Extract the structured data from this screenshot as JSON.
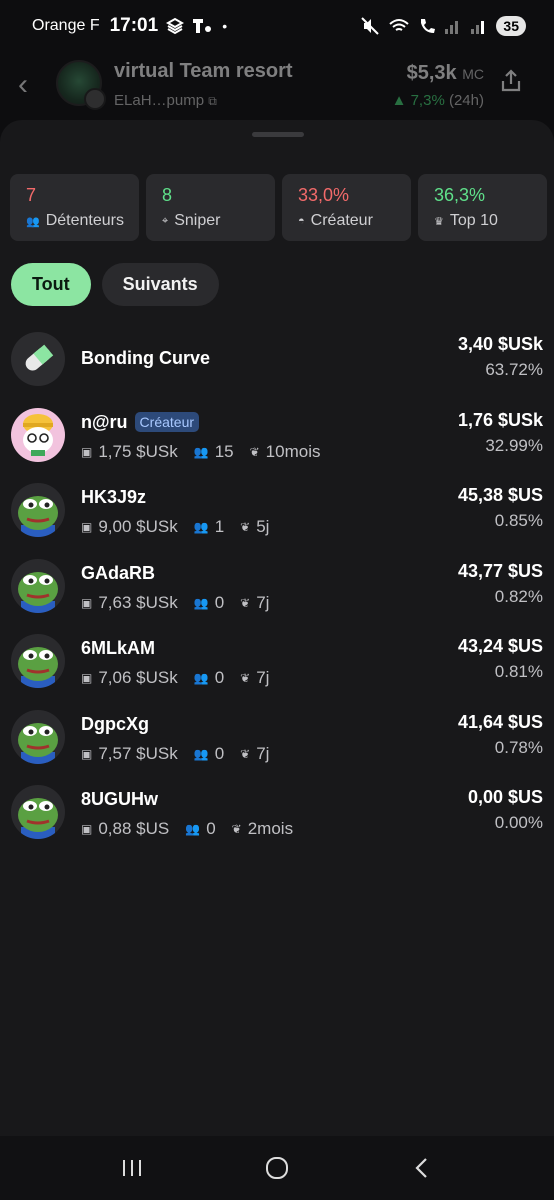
{
  "status_bar": {
    "carrier": "Orange F",
    "time": "17:01",
    "battery": "35"
  },
  "header": {
    "token_name": "virtual Team resort",
    "token_address": "ELaH…pump",
    "market_cap": "$5,3k",
    "market_cap_unit": "MC",
    "change": "7,3%",
    "change_period": "(24h)"
  },
  "stats": [
    {
      "value": "7",
      "label": "Détenteurs",
      "color": "#f26a6a"
    },
    {
      "value": "8",
      "label": "Sniper",
      "color": "#5fe08a"
    },
    {
      "value": "33,0%",
      "label": "Créateur",
      "color": "#f26a6a"
    },
    {
      "value": "36,3%",
      "label": "Top 10",
      "color": "#5fe08a"
    }
  ],
  "tabs": [
    {
      "label": "Tout",
      "active": true
    },
    {
      "label": "Suivants",
      "active": false
    }
  ],
  "holders": [
    {
      "name": "Bonding Curve",
      "amount": "3,40 $USk",
      "percent": "63.72%",
      "avatar": "pill-icon"
    },
    {
      "name": "n@ru",
      "badge": "Créateur",
      "sol": "1,75 $USk",
      "followers": "15",
      "age": "10mois",
      "amount": "1,76 $USk",
      "percent": "32.99%",
      "avatar": "cartoon-avatar"
    },
    {
      "name": "HK3J9z",
      "sol": "9,00 $USk",
      "followers": "1",
      "age": "5j",
      "amount": "45,38 $US",
      "percent": "0.85%",
      "avatar": "frog-avatar"
    },
    {
      "name": "GAdaRB",
      "sol": "7,63 $USk",
      "followers": "0",
      "age": "7j",
      "amount": "43,77 $US",
      "percent": "0.82%",
      "avatar": "frog-avatar"
    },
    {
      "name": "6MLkAM",
      "sol": "7,06 $USk",
      "followers": "0",
      "age": "7j",
      "amount": "43,24 $US",
      "percent": "0.81%",
      "avatar": "frog-avatar"
    },
    {
      "name": "DgpcXg",
      "sol": "7,57 $USk",
      "followers": "0",
      "age": "7j",
      "amount": "41,64 $US",
      "percent": "0.78%",
      "avatar": "frog-avatar"
    },
    {
      "name": "8UGUHw",
      "sol": "0,88 $US",
      "followers": "0",
      "age": "2mois",
      "amount": "0,00 $US",
      "percent": "0.00%",
      "avatar": "frog-avatar"
    }
  ]
}
